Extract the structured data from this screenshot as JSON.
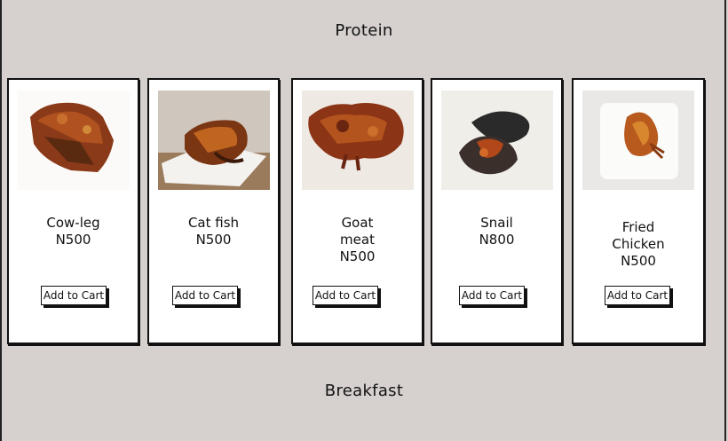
{
  "sections": {
    "protein_title": "Protein",
    "breakfast_title": "Breakfast"
  },
  "products": [
    {
      "name": "Cow-leg",
      "price": "N500",
      "button": "Add to Cart"
    },
    {
      "name": "Cat fish",
      "price": "N500",
      "button": "Add to Cart"
    },
    {
      "name_line1": "Goat",
      "name_line2": "meat",
      "price": "N500",
      "button": "Add to Cart"
    },
    {
      "name": "Snail",
      "price": "N800",
      "button": "Add to Cart"
    },
    {
      "name_line1": "Fried",
      "name_line2": "Chicken",
      "price": "N500",
      "button": "Add to Cart"
    }
  ],
  "colors": {
    "background": "#d6d0cf",
    "card": "#ffffff",
    "border": "#111111"
  }
}
